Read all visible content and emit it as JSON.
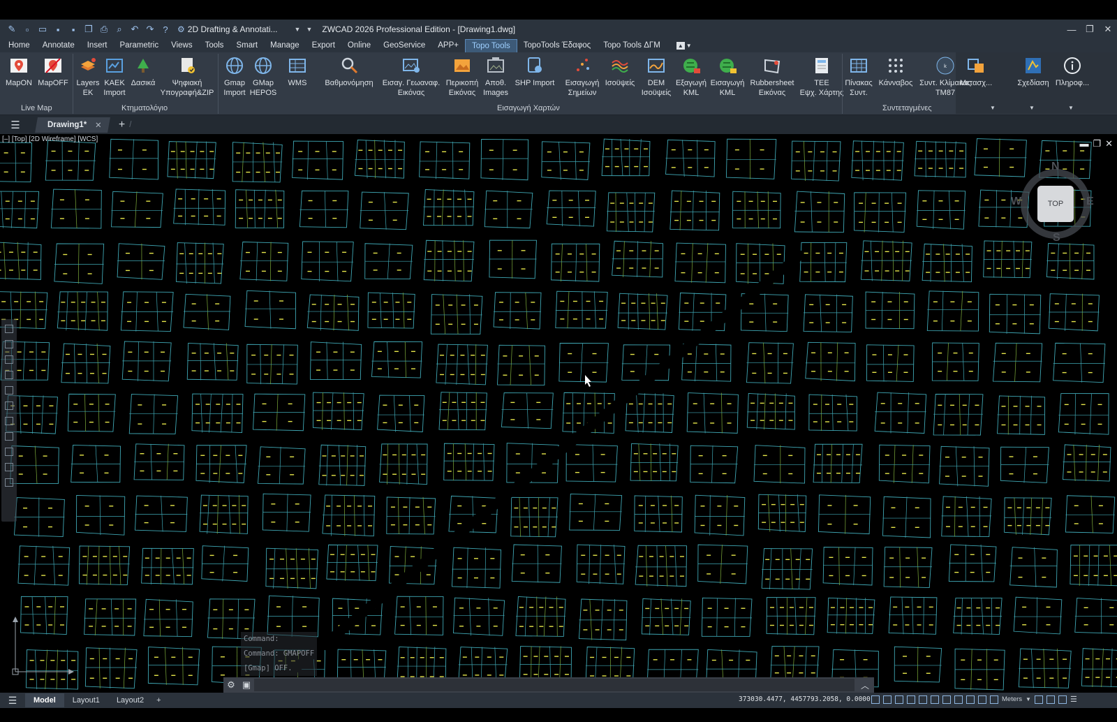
{
  "titlebar": {
    "workspace": "2D Drafting & Annotati...",
    "title": "ZWCAD 2026 Professional Edition - [Drawing1.dwg]"
  },
  "menu": [
    "Home",
    "Annotate",
    "Insert",
    "Parametric",
    "Views",
    "Tools",
    "Smart",
    "Manage",
    "Export",
    "Online",
    "GeoService",
    "APP+",
    "Topo Tools",
    "TopoTools Έδαφος",
    "Topo Tools ΔΓΜ"
  ],
  "menu_active": "Topo Tools",
  "ribbon": {
    "groups": {
      "live_map": "Live Map",
      "ktimatologio": "Κτηματολόγιο",
      "eisagogi_xarton": "Εισαγωγή Χαρτών",
      "syntetagmenes": "Συντεταγμένες"
    },
    "buttons": {
      "mapon": "MapON",
      "mapoff": "MapOFF",
      "layers_ek_1": "Layers",
      "layers_ek_2": "EK",
      "kaek_1": "KAEK",
      "kaek_2": "Import",
      "dasika": "Δασικά",
      "psifiaki_1": "Ψηφιακή",
      "psifiaki_2": "Υπογραφή&ZIP",
      "gmap_import_1": "Gmap",
      "gmap_import_2": "Import",
      "gmap_hepos_1": "GMap",
      "gmap_hepos_2": "HEPOS",
      "wms": "WMS",
      "vathmonomisi": "Βαθμονόμηση",
      "eisag_geo_1": "Εισαγ. Γεωαναφ.",
      "eisag_geo_2": "Εικόνας",
      "perikopi_1": "Περικοπή",
      "perikopi_2": "Εικόνας",
      "apoth_1": "Αποθ.",
      "apoth_2": "Images",
      "shp_import": "SHP Import",
      "eisagogi_simeion_1": "Εισαγωγή",
      "eisagogi_simeion_2": "Σημείων",
      "isoupseis": "Ισοϋψείς",
      "dem_1": "DEM",
      "dem_2": "Ισοϋψείς",
      "exagogi_kml_1": "Εξαγωγή",
      "exagogi_kml_2": "KML",
      "eisagogi_kml_1": "Εισαγωγή",
      "eisagogi_kml_2": "KML",
      "rubbersheet_1": "Rubbersheet",
      "rubbersheet_2": "Εικόνας",
      "tee_1": "TEE",
      "tee_2": "Εψχ. Χάρτης",
      "pinakas_1": "Πίνακας",
      "pinakas_2": "Συντ.",
      "kannavos": "Κάνναβος",
      "synt_klim_1": "Συντ. Κλίμακας",
      "synt_klim_2": "TM87",
      "metasx": "Μετασχ...",
      "sxediasi": "Σχεδίαση",
      "pliroforia": "Πληροφ..."
    }
  },
  "doc_tab": "Drawing1*",
  "viewport": {
    "label": "[–] [Top] [2D Wireframe] [WCS]",
    "viewcube_top": "TOP",
    "compass": {
      "n": "N",
      "s": "S",
      "e": "E",
      "w": "W"
    }
  },
  "command_history": [
    "Command:",
    "Command: GMAPOFF",
    "[Gmap] OFF."
  ],
  "layout_tabs": [
    "Model",
    "Layout1",
    "Layout2"
  ],
  "status": {
    "coordinates": "373030.4477, 4457793.2058, 0.0000",
    "units": "Meters"
  },
  "colors": {
    "parcel_line": "#3fa7b4",
    "parcel_line_green": "#7fae3c",
    "label_yellow": "#e6e64a",
    "accent": "#9fd0ff"
  }
}
